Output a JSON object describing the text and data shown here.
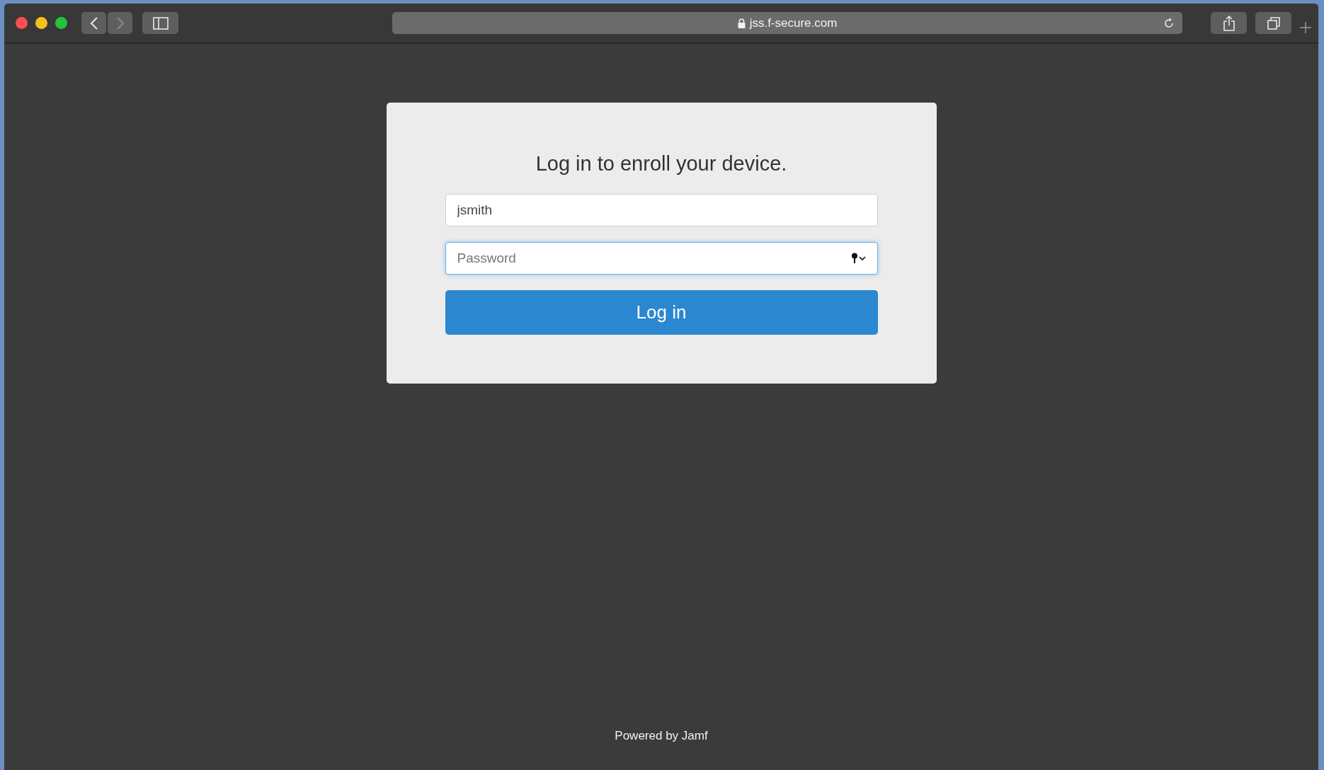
{
  "browser": {
    "url": "jss.f-secure.com",
    "back": {
      "disabled": false
    },
    "forward": {
      "disabled": true
    }
  },
  "login": {
    "title": "Log in to enroll your device.",
    "username": {
      "value": "jsmith",
      "focused": false
    },
    "password": {
      "placeholder": "Password",
      "focused": true
    },
    "button": "Log in"
  },
  "footer": "Powered by Jamf"
}
